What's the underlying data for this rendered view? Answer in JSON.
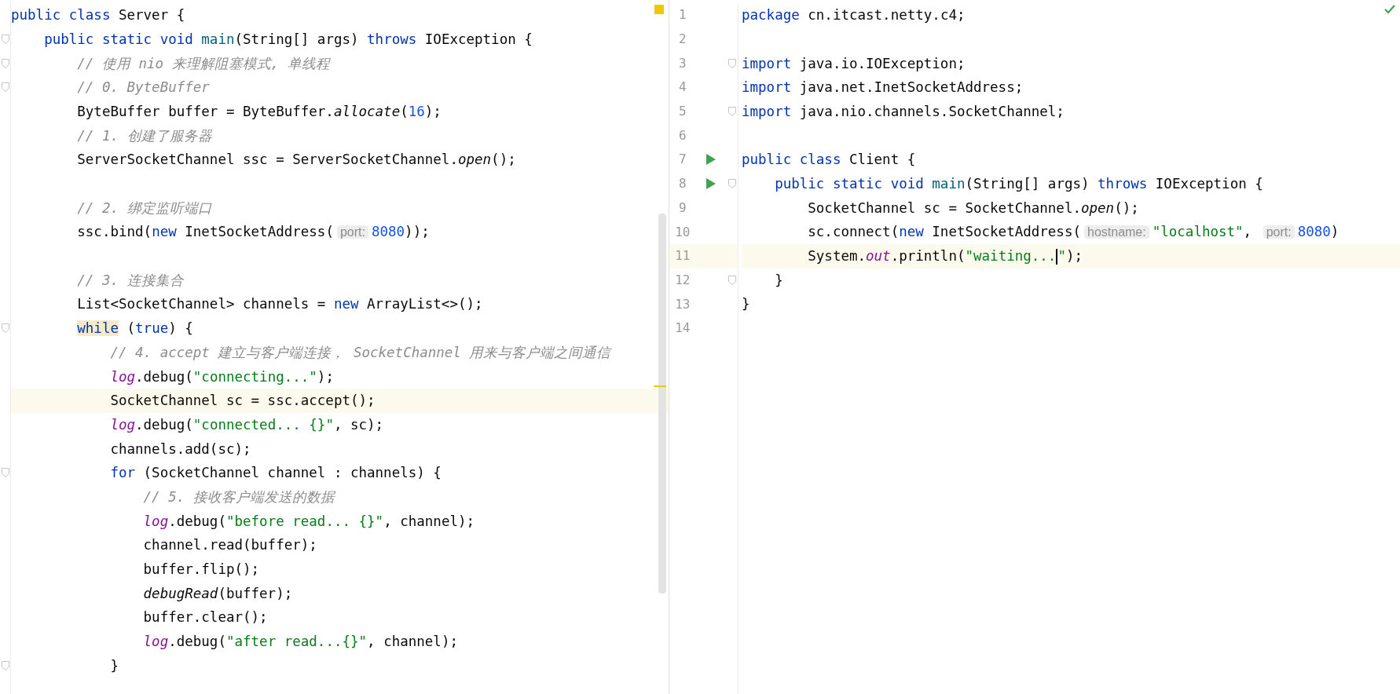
{
  "left_editor": {
    "lines": [
      {
        "current": false,
        "fold": false,
        "tokens": [
          {
            "kind": "kw",
            "text": "public class"
          },
          {
            "kind": "plain",
            "text": " Server {"
          }
        ]
      },
      {
        "current": false,
        "fold": true,
        "tokens": [
          {
            "kind": "kw",
            "text": "    public static void "
          },
          {
            "kind": "decl",
            "text": "main"
          },
          {
            "kind": "plain",
            "text": "(String[] args) "
          },
          {
            "kind": "kw",
            "text": "throws"
          },
          {
            "kind": "plain",
            "text": " IOException {"
          }
        ]
      },
      {
        "current": false,
        "fold": true,
        "tokens": [
          {
            "kind": "comment",
            "text": "        // 使用 nio 来理解阻塞模式, 单线程"
          }
        ]
      },
      {
        "current": false,
        "fold": true,
        "tokens": [
          {
            "kind": "comment",
            "text": "        // 0. ByteBuffer"
          }
        ]
      },
      {
        "current": false,
        "fold": false,
        "tokens": [
          {
            "kind": "plain",
            "text": "        ByteBuffer buffer = ByteBuffer."
          },
          {
            "kind": "italic",
            "text": "allocate"
          },
          {
            "kind": "plain",
            "text": "("
          },
          {
            "kind": "num",
            "text": "16"
          },
          {
            "kind": "plain",
            "text": ");"
          }
        ]
      },
      {
        "current": false,
        "fold": false,
        "tokens": [
          {
            "kind": "comment",
            "text": "        // 1. 创建了服务器"
          }
        ]
      },
      {
        "current": false,
        "fold": false,
        "tokens": [
          {
            "kind": "plain",
            "text": "        ServerSocketChannel ssc = ServerSocketChannel."
          },
          {
            "kind": "italic",
            "text": "open"
          },
          {
            "kind": "plain",
            "text": "();"
          }
        ]
      },
      {
        "current": false,
        "fold": false
      },
      {
        "current": false,
        "fold": false,
        "tokens": [
          {
            "kind": "comment",
            "text": "        // 2. 绑定监听端口"
          }
        ]
      },
      {
        "current": false,
        "fold": false,
        "tokens": [
          {
            "kind": "plain",
            "text": "        ssc.bind("
          },
          {
            "kind": "kw",
            "text": "new"
          },
          {
            "kind": "plain",
            "text": " InetSocketAddress("
          },
          {
            "kind": "hint",
            "text": "port:"
          },
          {
            "kind": "num",
            "text": "8080"
          },
          {
            "kind": "plain",
            "text": "));"
          }
        ]
      },
      {
        "current": false,
        "fold": false
      },
      {
        "current": false,
        "fold": false,
        "tokens": [
          {
            "kind": "comment",
            "text": "        // 3. 连接集合"
          }
        ]
      },
      {
        "current": false,
        "fold": false,
        "tokens": [
          {
            "kind": "plain",
            "text": "        List<SocketChannel> channels = "
          },
          {
            "kind": "kw",
            "text": "new"
          },
          {
            "kind": "plain",
            "text": " ArrayList<>();"
          }
        ]
      },
      {
        "current": false,
        "fold": true,
        "tokens": [
          {
            "kind": "kw_marked",
            "text": "        while"
          },
          {
            "kind": "plain",
            "text": " ("
          },
          {
            "kind": "kw",
            "text": "true"
          },
          {
            "kind": "plain",
            "text": ") {"
          }
        ]
      },
      {
        "current": false,
        "fold": false,
        "tokens": [
          {
            "kind": "comment",
            "text": "            // 4. accept 建立与客户端连接， SocketChannel 用来与客户端之间通信"
          }
        ]
      },
      {
        "current": false,
        "fold": false,
        "tokens": [
          {
            "kind": "static",
            "text": "            log"
          },
          {
            "kind": "plain",
            "text": ".debug("
          },
          {
            "kind": "str",
            "text": "\"connecting...\""
          },
          {
            "kind": "plain",
            "text": ");"
          }
        ]
      },
      {
        "current": true,
        "fold": false,
        "tokens": [
          {
            "kind": "plain",
            "text": "            SocketChannel sc = ssc.accept();"
          }
        ]
      },
      {
        "current": false,
        "fold": false,
        "tokens": [
          {
            "kind": "static",
            "text": "            log"
          },
          {
            "kind": "plain",
            "text": ".debug("
          },
          {
            "kind": "str",
            "text": "\"connected... {}\""
          },
          {
            "kind": "plain",
            "text": ", sc);"
          }
        ]
      },
      {
        "current": false,
        "fold": false,
        "tokens": [
          {
            "kind": "plain",
            "text": "            channels.add(sc);"
          }
        ]
      },
      {
        "current": false,
        "fold": true,
        "tokens": [
          {
            "kind": "kw",
            "text": "            for"
          },
          {
            "kind": "plain",
            "text": " (SocketChannel channel : channels) {"
          }
        ]
      },
      {
        "current": false,
        "fold": false,
        "tokens": [
          {
            "kind": "comment",
            "text": "                // 5. 接收客户端发送的数据"
          }
        ]
      },
      {
        "current": false,
        "fold": false,
        "tokens": [
          {
            "kind": "static",
            "text": "                log"
          },
          {
            "kind": "plain",
            "text": ".debug("
          },
          {
            "kind": "str",
            "text": "\"before read... {}\""
          },
          {
            "kind": "plain",
            "text": ", channel);"
          }
        ]
      },
      {
        "current": false,
        "fold": false,
        "tokens": [
          {
            "kind": "plain",
            "text": "                channel.read(buffer);"
          }
        ]
      },
      {
        "current": false,
        "fold": false,
        "tokens": [
          {
            "kind": "plain",
            "text": "                buffer.flip();"
          }
        ]
      },
      {
        "current": false,
        "fold": false,
        "tokens": [
          {
            "kind": "italic",
            "text": "                debugRead"
          },
          {
            "kind": "plain",
            "text": "(buffer);"
          }
        ]
      },
      {
        "current": false,
        "fold": false,
        "tokens": [
          {
            "kind": "plain",
            "text": "                buffer.clear();"
          }
        ]
      },
      {
        "current": false,
        "fold": false,
        "tokens": [
          {
            "kind": "static",
            "text": "                log"
          },
          {
            "kind": "plain",
            "text": ".debug("
          },
          {
            "kind": "str",
            "text": "\"after read...{}\""
          },
          {
            "kind": "plain",
            "text": ", channel);"
          }
        ]
      },
      {
        "current": false,
        "fold": true,
        "tokens": [
          {
            "kind": "plain",
            "text": "            }"
          }
        ]
      }
    ]
  },
  "right_editor": {
    "lines": [
      {
        "number": "1",
        "current": false,
        "fold": false,
        "run": false,
        "tokens": [
          {
            "kind": "kw",
            "text": "package"
          },
          {
            "kind": "plain",
            "text": " cn.itcast.netty.c4;"
          }
        ]
      },
      {
        "number": "2",
        "current": false,
        "fold": false,
        "run": false
      },
      {
        "number": "3",
        "current": false,
        "fold": true,
        "run": false,
        "tokens": [
          {
            "kind": "kw",
            "text": "import"
          },
          {
            "kind": "plain",
            "text": " java.io.IOException;"
          }
        ]
      },
      {
        "number": "4",
        "current": false,
        "fold": false,
        "run": false,
        "tokens": [
          {
            "kind": "kw",
            "text": "import"
          },
          {
            "kind": "plain",
            "text": " java.net.InetSocketAddress;"
          }
        ]
      },
      {
        "number": "5",
        "current": false,
        "fold": true,
        "run": false,
        "tokens": [
          {
            "kind": "kw",
            "text": "import"
          },
          {
            "kind": "plain",
            "text": " java.nio.channels.SocketChannel;"
          }
        ]
      },
      {
        "number": "6",
        "current": false,
        "fold": false,
        "run": false
      },
      {
        "number": "7",
        "current": false,
        "fold": false,
        "run": true,
        "tokens": [
          {
            "kind": "kw",
            "text": "public class"
          },
          {
            "kind": "plain",
            "text": " Client {"
          }
        ]
      },
      {
        "number": "8",
        "current": false,
        "fold": true,
        "run": true,
        "tokens": [
          {
            "kind": "kw",
            "text": "    public static void "
          },
          {
            "kind": "decl",
            "text": "main"
          },
          {
            "kind": "plain",
            "text": "(String[] args) "
          },
          {
            "kind": "kw",
            "text": "throws"
          },
          {
            "kind": "plain",
            "text": " IOException {"
          }
        ]
      },
      {
        "number": "9",
        "current": false,
        "fold": false,
        "run": false,
        "tokens": [
          {
            "kind": "plain",
            "text": "        SocketChannel sc = SocketChannel."
          },
          {
            "kind": "italic",
            "text": "open"
          },
          {
            "kind": "plain",
            "text": "();"
          }
        ]
      },
      {
        "number": "10",
        "current": false,
        "fold": false,
        "run": false,
        "tokens": [
          {
            "kind": "plain",
            "text": "        sc.connect("
          },
          {
            "kind": "kw",
            "text": "new"
          },
          {
            "kind": "plain",
            "text": " InetSocketAddress("
          },
          {
            "kind": "hint",
            "text": "hostname:"
          },
          {
            "kind": "str",
            "text": "\"localhost\""
          },
          {
            "kind": "plain",
            "text": ", "
          },
          {
            "kind": "hint",
            "text": "port:"
          },
          {
            "kind": "num",
            "text": "8080"
          },
          {
            "kind": "plain",
            "text": ")"
          }
        ]
      },
      {
        "number": "11",
        "current": true,
        "fold": false,
        "run": false,
        "tokens": [
          {
            "kind": "plain",
            "text": "        System."
          },
          {
            "kind": "static",
            "text": "out"
          },
          {
            "kind": "plain",
            "text": ".println("
          },
          {
            "kind": "str",
            "text": "\"waiting..."
          },
          {
            "kind": "caret"
          },
          {
            "kind": "str",
            "text": "\""
          },
          {
            "kind": "plain",
            "text": ");"
          }
        ]
      },
      {
        "number": "12",
        "current": false,
        "fold": true,
        "run": false,
        "tokens": [
          {
            "kind": "plain",
            "text": "    }"
          }
        ]
      },
      {
        "number": "13",
        "current": false,
        "fold": false,
        "run": false,
        "tokens": [
          {
            "kind": "plain",
            "text": "}"
          }
        ]
      },
      {
        "number": "14",
        "current": false,
        "fold": false,
        "run": false
      }
    ]
  }
}
